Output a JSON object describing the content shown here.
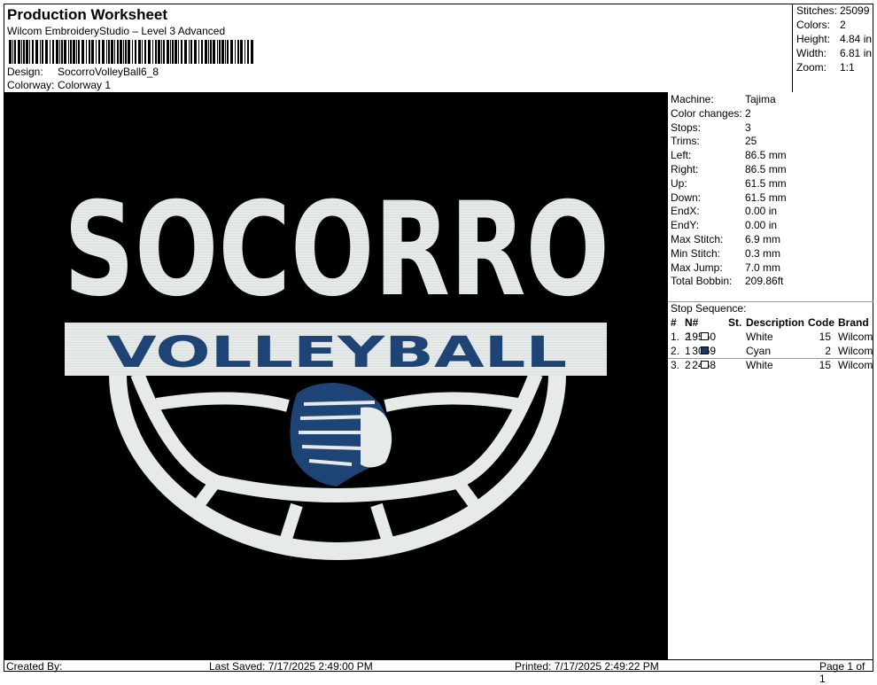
{
  "header": {
    "title": "Production Worksheet",
    "software": "Wilcom EmbroideryStudio – Level 3 Advanced",
    "design_label": "Design:",
    "design_value": "SocorroVolleyBall6_8",
    "colorway_label": "Colorway:",
    "colorway_value": "Colorway 1"
  },
  "stats": [
    {
      "label": "Stitches:",
      "value": "25099"
    },
    {
      "label": "Colors:",
      "value": "2"
    },
    {
      "label": "Height:",
      "value": "4.84 in"
    },
    {
      "label": "Width:",
      "value": "6.81 in"
    },
    {
      "label": "Zoom:",
      "value": "1:1"
    }
  ],
  "machine_info": [
    {
      "label": "Machine:",
      "value": "Tajima"
    },
    {
      "label": "Color changes:",
      "value": "2"
    },
    {
      "label": "Stops:",
      "value": "3"
    },
    {
      "label": "Trims:",
      "value": "25"
    },
    {
      "label": "Left:",
      "value": "86.5 mm"
    },
    {
      "label": "Right:",
      "value": "86.5 mm"
    },
    {
      "label": "Up:",
      "value": "61.5 mm"
    },
    {
      "label": "Down:",
      "value": "61.5 mm"
    },
    {
      "label": "EndX:",
      "value": "0.00 in"
    },
    {
      "label": "EndY:",
      "value": "0.00 in"
    },
    {
      "label": "Max Stitch:",
      "value": "6.9 mm"
    },
    {
      "label": "Min Stitch:",
      "value": "0.3 mm"
    },
    {
      "label": "Max Jump:",
      "value": "7.0 mm"
    },
    {
      "label": "Total Bobbin:",
      "value": "209.86ft"
    }
  ],
  "stop_sequence": {
    "title": "Stop Sequence:",
    "headers": {
      "num": "#",
      "n": "N#",
      "st": "St.",
      "description": "Description",
      "code": "Code",
      "brand": "Brand"
    },
    "rows": [
      {
        "num": "1.",
        "n": "2",
        "color": "#ffffff",
        "st": "19560",
        "description": "White",
        "code": "15",
        "brand": "Wilcom"
      },
      {
        "num": "2.",
        "n": "1",
        "color": "#1a3a66",
        "st": "3069",
        "description": "Cyan",
        "code": "2",
        "brand": "Wilcom"
      },
      {
        "num": "3.",
        "n": "2",
        "color": "#ffffff",
        "st": "2468",
        "description": "White",
        "code": "15",
        "brand": "Wilcom"
      }
    ]
  },
  "design": {
    "top_text": "SOCORRO",
    "band_text": "VOLLEYBALL",
    "colors": {
      "background": "#000000",
      "white": "#e6ebea",
      "navy": "#1d4475"
    }
  },
  "footer": {
    "created_by": "Created By:",
    "last_saved": "Last Saved: 7/17/2025 2:49:00 PM",
    "printed": "Printed: 7/17/2025 2:49:22 PM",
    "page": "Page 1 of 1"
  }
}
